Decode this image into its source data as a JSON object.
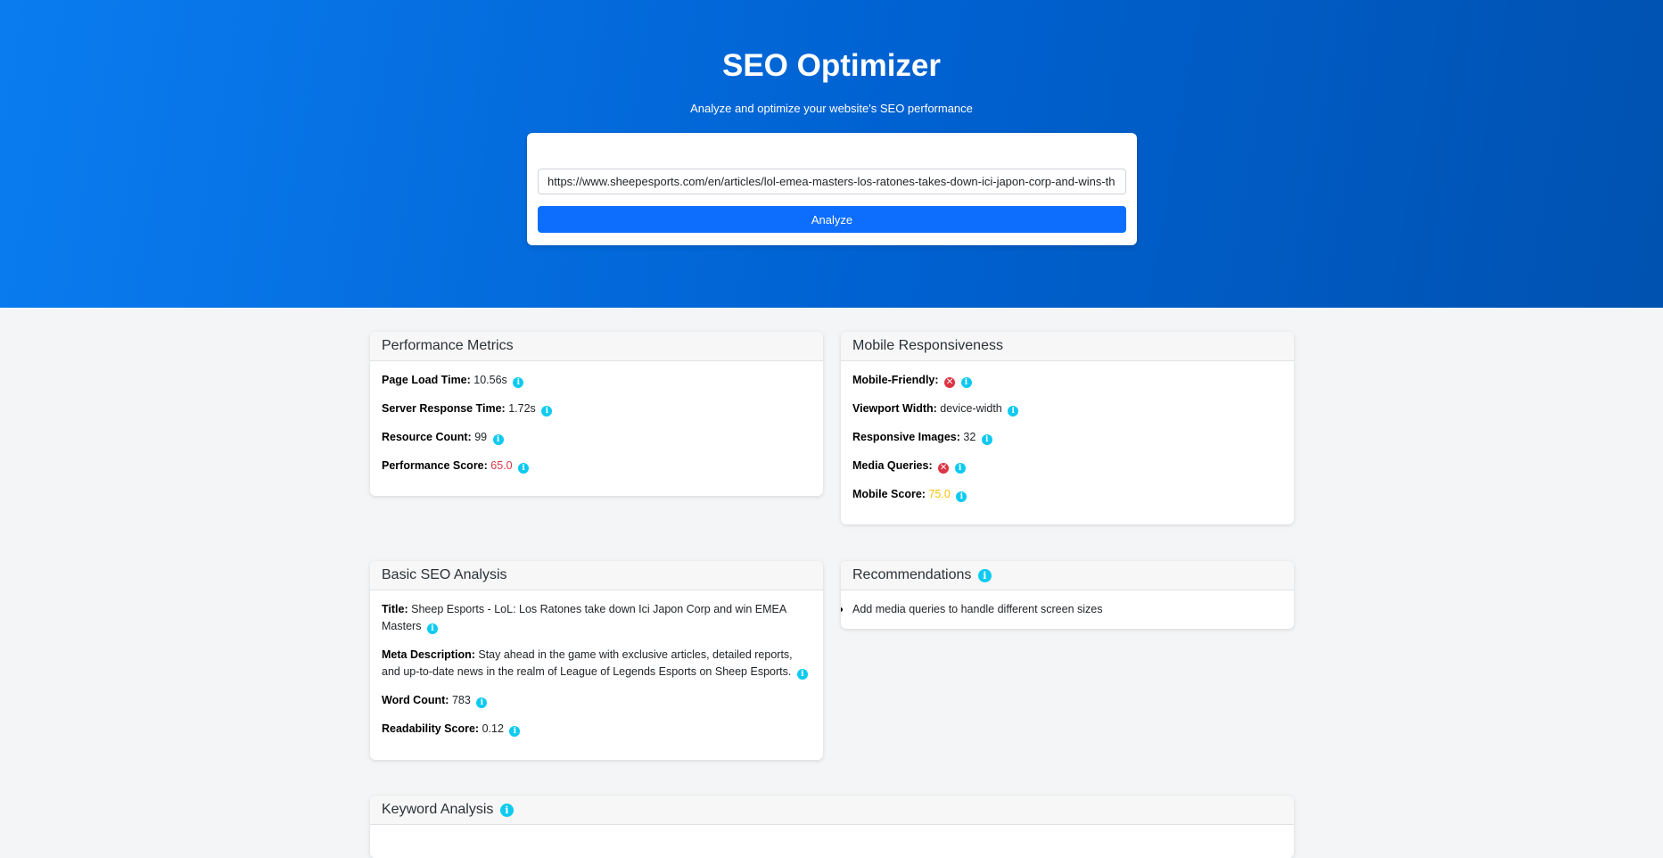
{
  "header": {
    "title": "SEO Optimizer",
    "subtitle": "Analyze and optimize your website's SEO performance",
    "url_value": "https://www.sheepesports.com/en/articles/lol-emea-masters-los-ratones-takes-down-ici-japon-corp-and-wins-th",
    "analyze_label": "Analyze"
  },
  "performance": {
    "title": "Performance Metrics",
    "page_load_label": "Page Load Time:",
    "page_load_value": "10.56s",
    "server_response_label": "Server Response Time:",
    "server_response_value": "1.72s",
    "resource_count_label": "Resource Count:",
    "resource_count_value": "99",
    "score_label": "Performance Score:",
    "score_value": "65.0"
  },
  "mobile": {
    "title": "Mobile Responsiveness",
    "friendly_label": "Mobile-Friendly:",
    "viewport_label": "Viewport Width:",
    "viewport_value": "device-width",
    "responsive_images_label": "Responsive Images:",
    "responsive_images_value": "32",
    "media_queries_label": "Media Queries:",
    "score_label": "Mobile Score:",
    "score_value": "75.0"
  },
  "basic_seo": {
    "title": "Basic SEO Analysis",
    "title_label": "Title:",
    "title_value": "Sheep Esports - LoL: Los Ratones take down Ici Japon Corp and win EMEA Masters",
    "meta_label": "Meta Description:",
    "meta_value": "Stay ahead in the game with exclusive articles, detailed reports, and up-to-date news in the realm of League of Legends Esports on Sheep Esports.",
    "word_count_label": "Word Count:",
    "word_count_value": "783",
    "readability_label": "Readability Score:",
    "readability_value": "0.12"
  },
  "recommendations": {
    "title": "Recommendations",
    "items": [
      "Add media queries to handle different screen sizes"
    ]
  },
  "keyword": {
    "title": "Keyword Analysis"
  },
  "icons": {
    "info_glyph": "i",
    "fail_glyph": "✕"
  },
  "colors": {
    "primary": "#0d6efd",
    "info": "#0dcaf0",
    "danger": "#dc3545",
    "warning": "#ffc107"
  }
}
